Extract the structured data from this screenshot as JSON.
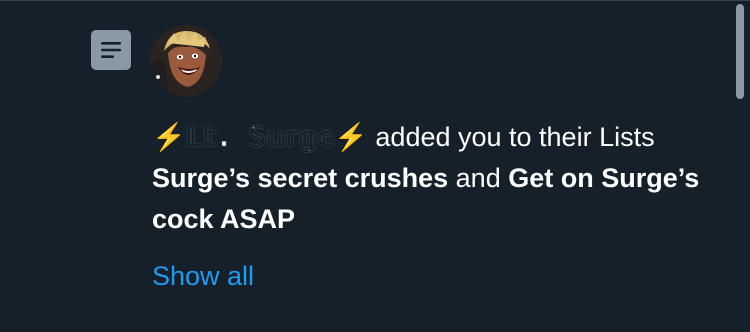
{
  "notification": {
    "icon": "list-icon",
    "avatar": "user-avatar",
    "actor_emoji_left": "⚡",
    "actor_name": "𝕃𝕥. 𝕊𝕦𝕣𝕘𝕖",
    "actor_emoji_right": "⚡",
    "action_text": " added you to their Lists ",
    "list_1": "Surge’s secret crushes",
    "conjunction": " and ",
    "list_2": "Get on Surge’s cock ASAP",
    "show_all_label": "Show all"
  },
  "colors": {
    "background": "#15202b",
    "text": "#ffffff",
    "link": "#1d9bf0",
    "icon_bg": "#8b98a5",
    "bolt": "#ffcc33"
  }
}
